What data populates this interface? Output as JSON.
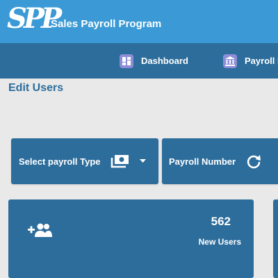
{
  "header": {
    "logo_text": "SPP",
    "app_title": "Sales Payroll Program",
    "logo_icon": "spp-logo",
    "background_color": "#3b9ad6"
  },
  "nav": {
    "background_color": "#2d6d9c",
    "items": [
      {
        "label": "Dashboard",
        "icon": "dashboard-icon"
      },
      {
        "label": "Payroll I",
        "icon": "bank-icon"
      }
    ]
  },
  "page": {
    "heading": "Edit Users"
  },
  "filters": {
    "payroll_type": {
      "label": "Select payroll Type",
      "icon": "money-icon",
      "dropdown_icon": "caret-down-icon"
    },
    "payroll_number": {
      "label": "Payroll Number",
      "icon": "refresh-icon"
    }
  },
  "stats": {
    "new_users": {
      "value": "562",
      "label": "New Users",
      "icon": "add-user-icon"
    }
  }
}
